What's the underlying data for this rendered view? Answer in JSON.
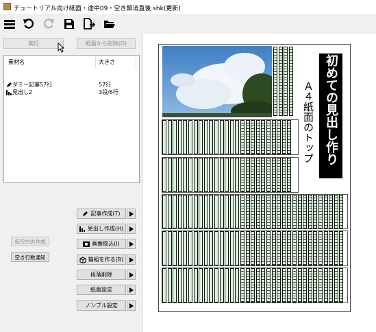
{
  "window": {
    "title": "チュートリアル向け紙面・途中09・空き解消直後.shk(更新)"
  },
  "toolbar": {
    "items": [
      {
        "icon": "menu-icon"
      },
      {
        "icon": "undo-icon"
      },
      {
        "icon": "redo-icon"
      },
      {
        "icon": "save-icon"
      },
      {
        "icon": "export-icon"
      },
      {
        "icon": "folder-icon"
      }
    ]
  },
  "actions": {
    "run_label": "実行",
    "remove_from_page_label": "紙面から削除(D)"
  },
  "list": {
    "columns": [
      "素材名",
      "大きさ"
    ],
    "rows": [
      {
        "icon": "pencil-icon",
        "name": "ダミー記事57行",
        "size": "57行"
      },
      {
        "icon": "bar-chart-icon",
        "name": "見出し2",
        "size": "3段/6行"
      }
    ]
  },
  "left_buttons": {
    "fake_space_label": "仮空白の作成",
    "empty_lines_notice_label": "空き行数通知"
  },
  "side_buttons": [
    {
      "icon": "pencil-icon",
      "label": "記事作成(T)"
    },
    {
      "icon": "bar-chart-icon",
      "label": "見出し作成(H)"
    },
    {
      "icon": "image-icon",
      "label": "画像取込(I)"
    },
    {
      "icon": "box-icon",
      "label": "箱組を作る(B)"
    },
    {
      "icon": "",
      "label": "段落削除"
    },
    {
      "icon": "",
      "label": "紙面設定"
    },
    {
      "icon": "",
      "label": "ノンブル設定"
    }
  ],
  "preview": {
    "headline_main": "初めての見出し作り",
    "headline_sub": "Ａ４紙面のトップ"
  },
  "colors": {
    "column_fill": "#d9f2d9",
    "headline_bg": "#000000",
    "sky": "#4a86c8"
  }
}
